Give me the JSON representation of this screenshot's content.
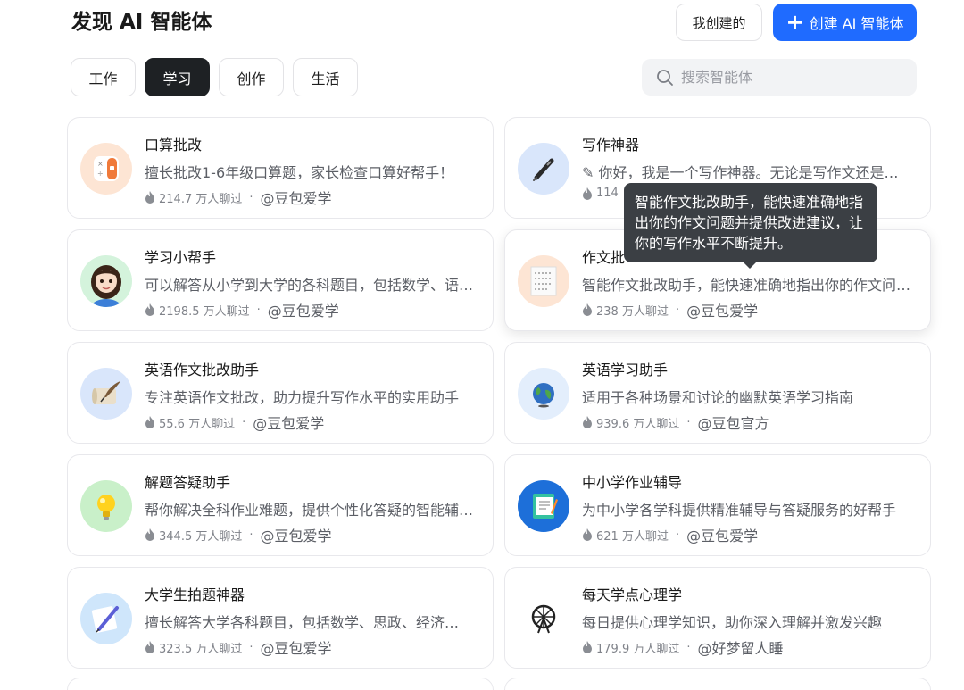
{
  "header": {
    "title": "发现 AI 智能体",
    "my_created_label": "我创建的",
    "create_label": "创建 AI 智能体",
    "create_icon": "plus-icon"
  },
  "tabs": [
    {
      "label": "工作",
      "active": false
    },
    {
      "label": "学习",
      "active": true
    },
    {
      "label": "创作",
      "active": false
    },
    {
      "label": "生活",
      "active": false
    }
  ],
  "search": {
    "placeholder": "搜索智能体",
    "value": "",
    "icon": "search-icon"
  },
  "colors": {
    "accent": "#1f6bff",
    "active_tab": "#1e2124",
    "tooltip_bg": "#3b3f44"
  },
  "agents": [
    {
      "name": "口算批改",
      "desc": "擅长批改1-6年级口算题，家长检查口算好帮手！",
      "chats": "214.7 万人聊过",
      "author": "@豆包爱学",
      "icon": "calculator-icon"
    },
    {
      "name": "写作神器",
      "desc": "✎ 你好，我是一个写作神器。无论是写作文还是…",
      "chats": "114",
      "author": "",
      "icon": "pen-icon"
    },
    {
      "name": "学习小帮手",
      "desc": "可以解答从小学到大学的各科题目，包括数学、语…",
      "chats": "2198.5 万人聊过",
      "author": "@豆包爱学",
      "icon": "girl-avatar-icon"
    },
    {
      "name": "作文批",
      "desc": "智能作文批改助手，能快速准确地指出你的作文问…",
      "chats": "238 万人聊过",
      "author": "@豆包爱学",
      "icon": "essay-paper-icon"
    },
    {
      "name": "英语作文批改助手",
      "desc": "专注英语作文批改，助力提升写作水平的实用助手",
      "chats": "55.6 万人聊过",
      "author": "@豆包爱学",
      "icon": "quill-scroll-icon"
    },
    {
      "name": "英语学习助手",
      "desc": "适用于各种场景和讨论的幽默英语学习指南",
      "chats": "939.6 万人聊过",
      "author": "@豆包官方",
      "icon": "globe-icon"
    },
    {
      "name": "解题答疑助手",
      "desc": "帮你解决全科作业难题，提供个性化答疑的智能辅…",
      "chats": "344.5 万人聊过",
      "author": "@豆包爱学",
      "icon": "lightbulb-icon"
    },
    {
      "name": "中小学作业辅导",
      "desc": "为中小学各学科提供精准辅导与答疑服务的好帮手",
      "chats": "621 万人聊过",
      "author": "@豆包爱学",
      "icon": "notebook-icon"
    },
    {
      "name": "大学生拍题神器",
      "desc": "擅长解答大学各科题目，包括数学、思政、经济…",
      "chats": "323.5 万人聊过",
      "author": "@豆包爱学",
      "icon": "pencil-paper-icon"
    },
    {
      "name": "每天学点心理学",
      "desc": "每日提供心理学知识，助你深入理解并激发兴趣",
      "chats": "179.9 万人聊过",
      "author": "@好梦留人睡",
      "icon": "ferris-wheel-icon"
    }
  ],
  "tooltip": {
    "text": "智能作文批改助手，能快速准确地指出你的作文问题并提供改进建议，让你的写作水平不断提升。"
  }
}
